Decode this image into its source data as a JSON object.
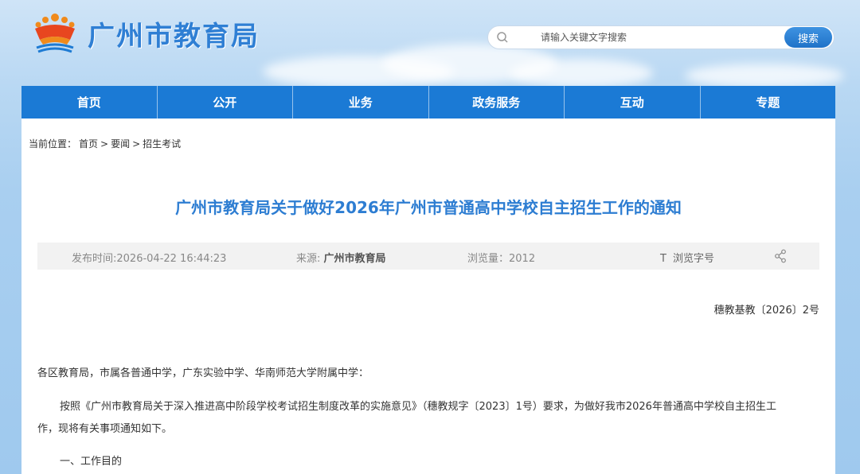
{
  "header": {
    "site_name": "广州市教育局",
    "search_placeholder": "请输入关键文字搜索",
    "search_button": "搜索"
  },
  "nav": {
    "items": [
      "首页",
      "公开",
      "业务",
      "政务服务",
      "互动",
      "专题"
    ]
  },
  "breadcrumb": {
    "label": "当前位置：",
    "items": [
      "首页",
      "要闻",
      "招生考试"
    ],
    "separator": ">"
  },
  "article": {
    "title": "广州市教育局关于做好2026年广州市普通高中学校自主招生工作的通知",
    "meta": {
      "publish_time": "发布时间:2026-04-22 16:44:23",
      "source_label": "来源:",
      "source_value": "广州市教育局",
      "views": "浏览量：2012",
      "font_size_icon_label": "T",
      "font_size_label": "浏览字号"
    },
    "doc_number": "穗教基教〔2026〕2号",
    "salutation": "各区教育局，市属各普通中学，广东实验中学、华南师范大学附属中学：",
    "intro_line1": "按照《广州市教育局关于深入推进高中阶段学校考试招生制度改革的实施意见》（穗教规字〔2023〕1号）要求，为做好我市2026年普通高中学校自主招生工",
    "intro_line2": "作，现将有关事项通知如下。",
    "section1": "一、工作目的"
  },
  "colors": {
    "brand_blue": "#1b7ad5",
    "title_blue": "#2d7dd2"
  }
}
